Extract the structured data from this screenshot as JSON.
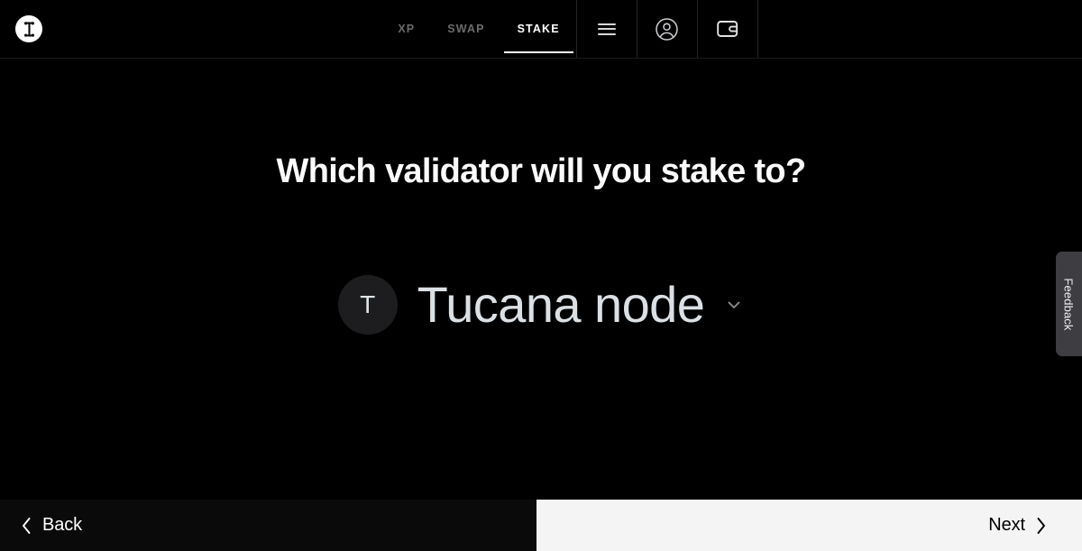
{
  "header": {
    "logo_icon": "ibeam-logo-icon",
    "tabs": [
      {
        "label": "XP",
        "active": false
      },
      {
        "label": "SWAP",
        "active": false
      },
      {
        "label": "STAKE",
        "active": true
      }
    ],
    "icons": [
      {
        "name": "menu-icon",
        "title": "Menu"
      },
      {
        "name": "account-circle-icon",
        "title": "Account"
      },
      {
        "name": "wallet-icon",
        "title": "Wallet"
      }
    ]
  },
  "main": {
    "headline": "Which validator will you stake to?",
    "validator": {
      "avatar_initial": "T",
      "name": "Tucana node",
      "chevron_icon": "chevron-down-icon"
    }
  },
  "feedback": {
    "label": "Feedback"
  },
  "footer": {
    "back_label": "Back",
    "back_icon": "chevron-left-icon",
    "next_label": "Next",
    "next_icon": "chevron-right-icon"
  },
  "colors": {
    "page_background": "#000000",
    "header_background": "#000000",
    "footer_back_background": "#0a0a0a",
    "footer_next_background": "#f4f4f5",
    "accent_text": "#ffffff",
    "muted_text": "#6b6b6d",
    "validator_name": "#dbe0e5",
    "avatar_background": "#1d1d1f",
    "feedback_background": "#3e3e42"
  }
}
